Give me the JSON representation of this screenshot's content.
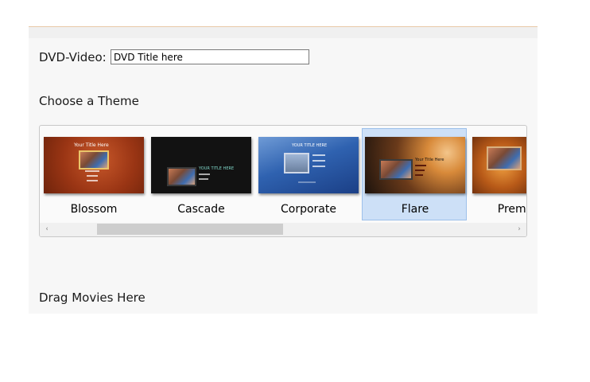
{
  "dvd": {
    "label": "DVD-Video:",
    "title_value": "DVD Title here"
  },
  "themes": {
    "heading": "Choose a Theme",
    "items": [
      {
        "name": "Blossom",
        "selected": false,
        "thumb_title": "Your Title Here"
      },
      {
        "name": "Cascade",
        "selected": false,
        "thumb_title": "YOUR TITLE HERE"
      },
      {
        "name": "Corporate",
        "selected": false,
        "thumb_title": "YOUR TITLE HERE"
      },
      {
        "name": "Flare",
        "selected": true,
        "thumb_title": "Your Title Here"
      },
      {
        "name": "Premiere",
        "selected": false,
        "thumb_title": ""
      }
    ],
    "scroll_left_icon": "‹",
    "scroll_right_icon": "›"
  },
  "drag": {
    "label": "Drag Movies Here"
  },
  "colors": {
    "selection": "#cde0f7",
    "panel": "#f7f7f7",
    "accent_line": "#e9c9a7"
  }
}
